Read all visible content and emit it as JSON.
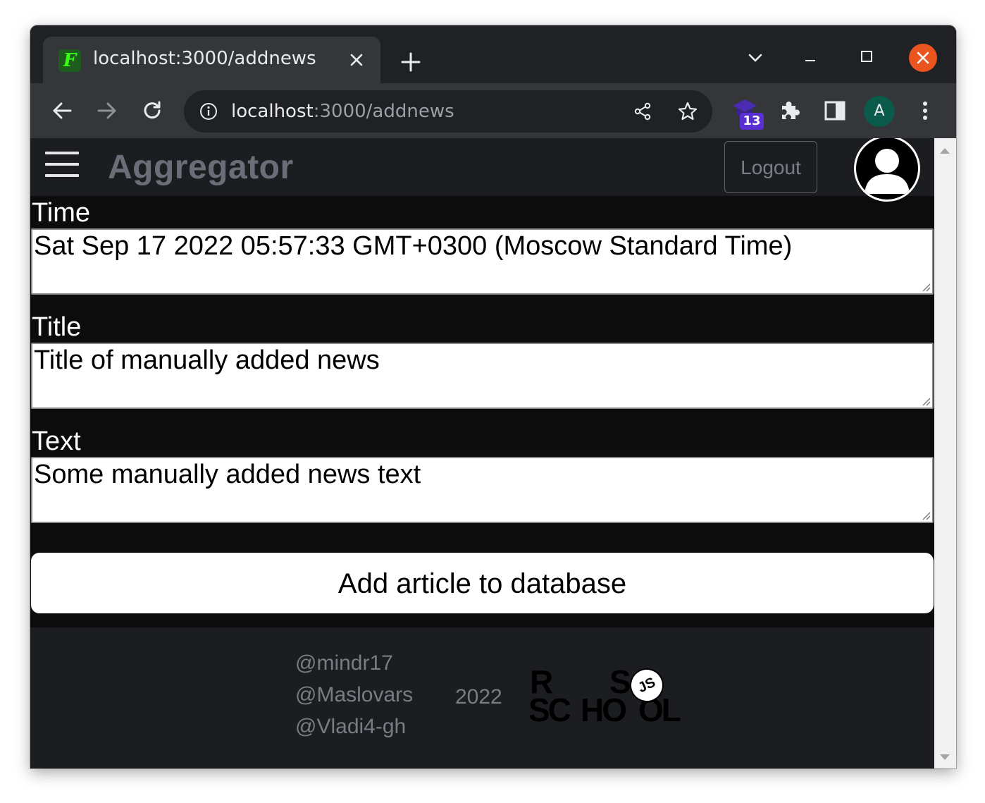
{
  "browser": {
    "tab": {
      "title": "localhost:3000/addnews",
      "favicon_letter": "F"
    },
    "address": {
      "host": "localhost",
      "path": ":3000/addnews"
    },
    "extension_badge": "13",
    "profile_initial": "A",
    "icons": {
      "back": "arrow-left-icon",
      "forward": "arrow-right-icon",
      "reload": "reload-icon",
      "site_info": "info-icon",
      "share": "share-icon",
      "bookmark": "star-icon",
      "extensions": "puzzle-icon",
      "side_panel": "side-panel-icon",
      "menu": "kebab-menu-icon"
    },
    "colors": {
      "frame": "#202124",
      "toolbar": "#35363a",
      "close_button": "#e9541f"
    }
  },
  "header": {
    "brand": "Aggregator",
    "logout_label": "Logout"
  },
  "form": {
    "time_label": "Time",
    "time_value": "Sat Sep 17 2022 05:57:33 GMT+0300 (Moscow Standard Time)",
    "title_label": "Title",
    "title_value": "Title of manually added news",
    "text_label": "Text",
    "text_value": "Some manually added news text",
    "submit_label": "Add article to database"
  },
  "footer": {
    "authors": [
      "@mindr17",
      "@Maslovars",
      "@Vladi4-gh"
    ],
    "year": "2022",
    "logo": {
      "r": "R",
      "s": "S",
      "school_sc": "SC",
      "school_ho": "HO",
      "school_ol": "OL",
      "js": "JS"
    }
  }
}
